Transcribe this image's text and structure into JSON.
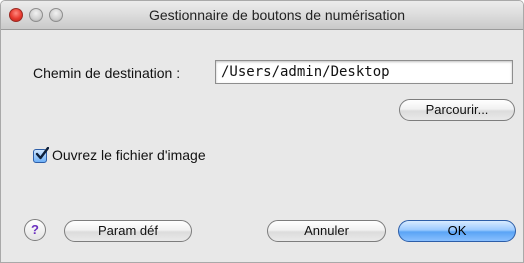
{
  "window": {
    "title": "Gestionnaire de boutons de numérisation"
  },
  "destination": {
    "label": "Chemin de destination :",
    "value": "/Users/admin/Desktop"
  },
  "buttons": {
    "browse": "Parcourir...",
    "defaults": "Param déf",
    "cancel": "Annuler",
    "ok": "OK",
    "help": "?"
  },
  "open_image": {
    "label": "Ouvrez le fichier d'image",
    "checked": true
  },
  "colors": {
    "accent": "#5aa4f5",
    "close_button": "#e83a2f"
  },
  "icons": {
    "help": "question-mark-icon",
    "checkbox": "checkmark-icon"
  }
}
